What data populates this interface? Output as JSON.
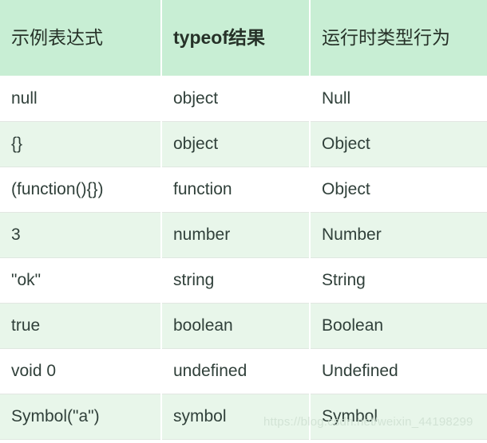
{
  "table": {
    "columns": [
      {
        "label": "示例表达式",
        "bold": false
      },
      {
        "label": "typeof结果",
        "bold": true
      },
      {
        "label": "运行时类型行为",
        "bold": false
      }
    ],
    "rows": [
      {
        "expression": "null",
        "typeof": "object",
        "runtime_type": "Null"
      },
      {
        "expression": "{}",
        "typeof": "object",
        "runtime_type": "Object"
      },
      {
        "expression": "(function(){})",
        "typeof": "function",
        "runtime_type": "Object"
      },
      {
        "expression": "3",
        "typeof": "number",
        "runtime_type": "Number"
      },
      {
        "expression": "\"ok\"",
        "typeof": "string",
        "runtime_type": "String"
      },
      {
        "expression": "true",
        "typeof": "boolean",
        "runtime_type": "Boolean"
      },
      {
        "expression": "void 0",
        "typeof": "undefined",
        "runtime_type": "Undefined"
      },
      {
        "expression": "Symbol(\"a\")",
        "typeof": "symbol",
        "runtime_type": "Symbol"
      }
    ]
  },
  "watermark": {
    "text": "https://blog.csdn.net/weixin_44198299"
  },
  "colors": {
    "header_bg": "#c8eed4",
    "row_alt_bg": "#e8f6ea",
    "row_bg": "#ffffff",
    "text": "#30403a",
    "divider": "#ffffff"
  }
}
